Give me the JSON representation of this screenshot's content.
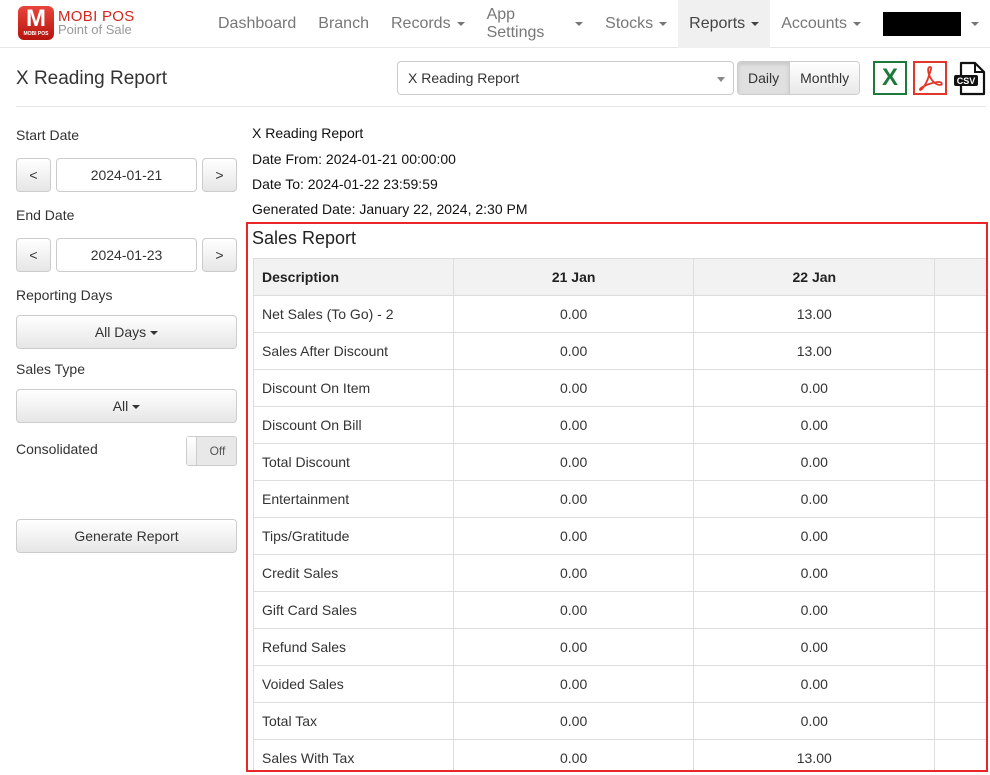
{
  "brand": {
    "logo_letter": "M",
    "logo_sub": "MOBI POS",
    "name": "MOBI POS",
    "tagline": "Point of Sale"
  },
  "nav": {
    "items": [
      {
        "label": "Dashboard",
        "dropdown": false
      },
      {
        "label": "Branch",
        "dropdown": false
      },
      {
        "label": "Records",
        "dropdown": true
      },
      {
        "label": "App Settings",
        "dropdown": true
      },
      {
        "label": "Stocks",
        "dropdown": true
      },
      {
        "label": "Reports",
        "dropdown": true,
        "active": true
      },
      {
        "label": "Accounts",
        "dropdown": true
      }
    ],
    "user": {
      "name": "[redacted]",
      "dropdown": true
    }
  },
  "header": {
    "title": "X Reading Report",
    "report_select": {
      "value": "X Reading Report"
    },
    "period_toggle": {
      "options": [
        "Daily",
        "Monthly"
      ],
      "selected": "Daily"
    },
    "export": [
      {
        "label": "X",
        "icon": "excel-icon"
      },
      {
        "label": "PDF",
        "icon": "pdf-icon"
      },
      {
        "label": "CSV",
        "icon": "csv-icon"
      }
    ]
  },
  "sidebar": {
    "start_date": {
      "label": "Start Date",
      "value": "2024-01-21",
      "prev": "<",
      "next": ">"
    },
    "end_date": {
      "label": "End Date",
      "value": "2024-01-23",
      "prev": "<",
      "next": ">"
    },
    "reporting_days": {
      "label": "Reporting Days",
      "value": "All Days"
    },
    "sales_type": {
      "label": "Sales Type",
      "value": "All"
    },
    "consolidated": {
      "label": "Consolidated",
      "state": "Off"
    },
    "generate_label": "Generate Report"
  },
  "report": {
    "name": "X Reading Report",
    "date_from": "Date From: 2024-01-21 00:00:00",
    "date_to": "Date To: 2024-01-22 23:59:59",
    "generated": "Generated Date: January 22, 2024, 2:30 PM",
    "section_title": "Sales Report",
    "columns": [
      "Description",
      "21 Jan",
      "22 Jan",
      ""
    ],
    "rows": [
      {
        "desc": "Net Sales (To Go) - 2",
        "values": [
          "0.00",
          "13.00"
        ]
      },
      {
        "desc": "Sales After Discount",
        "values": [
          "0.00",
          "13.00"
        ]
      },
      {
        "desc": "Discount On Item",
        "values": [
          "0.00",
          "0.00"
        ]
      },
      {
        "desc": "Discount On Bill",
        "values": [
          "0.00",
          "0.00"
        ]
      },
      {
        "desc": "Total Discount",
        "values": [
          "0.00",
          "0.00"
        ]
      },
      {
        "desc": "Entertainment",
        "values": [
          "0.00",
          "0.00"
        ]
      },
      {
        "desc": "Tips/Gratitude",
        "values": [
          "0.00",
          "0.00"
        ]
      },
      {
        "desc": "Credit Sales",
        "values": [
          "0.00",
          "0.00"
        ]
      },
      {
        "desc": "Gift Card Sales",
        "values": [
          "0.00",
          "0.00"
        ]
      },
      {
        "desc": "Refund Sales",
        "values": [
          "0.00",
          "0.00"
        ]
      },
      {
        "desc": "Voided Sales",
        "values": [
          "0.00",
          "0.00"
        ]
      },
      {
        "desc": "Total Tax",
        "values": [
          "0.00",
          "0.00"
        ]
      },
      {
        "desc": "Sales With Tax",
        "values": [
          "0.00",
          "13.00"
        ]
      }
    ]
  },
  "colors": {
    "brand_red": "#d0281f",
    "highlight_border": "#e8262a",
    "excel_green": "#1d7a3a",
    "pdf_red": "#e1362a"
  }
}
